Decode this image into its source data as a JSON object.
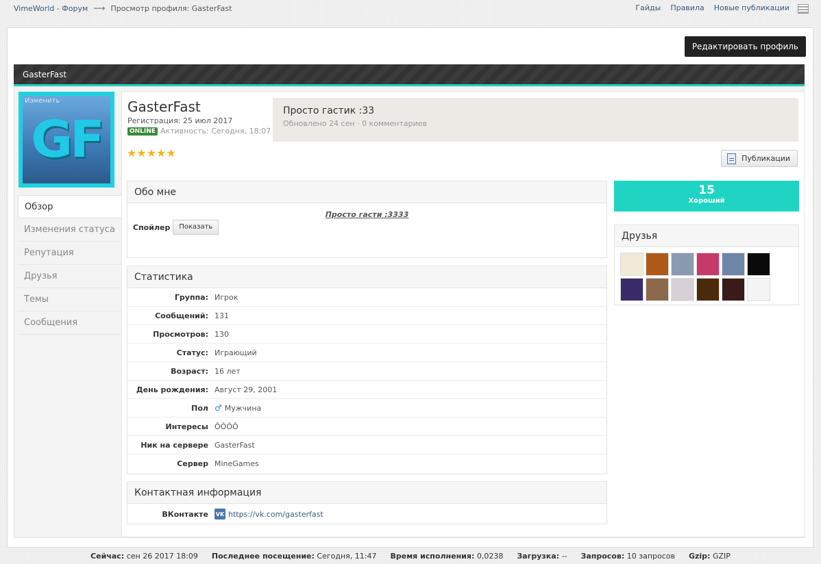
{
  "breadcrumb": {
    "home": "VimeWorld - Форум",
    "arrow": "⟶",
    "current": "Просмотр профиля: GasterFast"
  },
  "toplinks": [
    "Гайды",
    "Правила",
    "Новые публикации"
  ],
  "edit_profile": "Редактировать профиль",
  "header_title": "GasterFast",
  "avatar": {
    "change_label": "Изменить",
    "letters": "GF"
  },
  "nav": [
    {
      "label": "Обзор",
      "active": true
    },
    {
      "label": "Изменения статуса"
    },
    {
      "label": "Репутация"
    },
    {
      "label": "Друзья"
    },
    {
      "label": "Темы"
    },
    {
      "label": "Сообщения"
    }
  ],
  "profile": {
    "name": "GasterFast",
    "registered": "Регистрация: 25 июл 2017",
    "online": "ONLINE",
    "activity": "Активность: Сегодня, 18:07",
    "stars": "★★★★★"
  },
  "status": {
    "text": "Просто гастик :33",
    "meta": "Обновлено 24 сен · 0 комментариев"
  },
  "publications_btn": "Публикации",
  "about": {
    "title": "Обо мне",
    "quote": "Просто гасти :3333",
    "spoiler_label": "Спойлер",
    "show_btn": "Показать"
  },
  "stats": {
    "title": "Статистика",
    "rows": [
      {
        "label": "Группа:",
        "value": "Игрок"
      },
      {
        "label": "Сообщений:",
        "value": "131"
      },
      {
        "label": "Просмотров:",
        "value": "130"
      },
      {
        "label": "Статус:",
        "value": "Играющий"
      },
      {
        "label": "Возраст:",
        "value": "16 лет"
      },
      {
        "label": "День рождения:",
        "value": "Август 29, 2001"
      },
      {
        "label": "Пол",
        "value": "Мужчина",
        "icon": "male-icon"
      },
      {
        "label": "Интересы",
        "value": "ÔÔÔÔ"
      },
      {
        "label": "Ник на сервере",
        "value": "GasterFast"
      },
      {
        "label": "Сервер",
        "value": "MineGames"
      }
    ]
  },
  "contact": {
    "title": "Контактная информация",
    "label": "ВКонтакте",
    "icon_text": "VK",
    "value": "https://vk.com/gasterfast"
  },
  "reputation": {
    "value": "15",
    "label": "Хороший"
  },
  "friends": {
    "title": "Друзья",
    "colors": [
      "#f1ead8",
      "#b05a1a",
      "#8a9ab0",
      "#c63a6a",
      "#6f86a8",
      "#0a0a0a",
      "#3a2a6a",
      "#8a6a4a",
      "#d6d0d6",
      "#4a2a0a",
      "#3a1a1a",
      "#f4f4f4"
    ]
  },
  "footer": {
    "now_label": "Сейчас:",
    "now": "сен 26 2017 18:09",
    "last_label": "Последнее посещение:",
    "last": "Сегодня, 11:47",
    "exec_label": "Время исполнения:",
    "exec": "0,0238",
    "load_label": "Загрузка:",
    "load": "--",
    "queries_label": "Запросов:",
    "queries": "10 запросов",
    "gzip_label": "Gzip:",
    "gzip": "GZIP"
  }
}
